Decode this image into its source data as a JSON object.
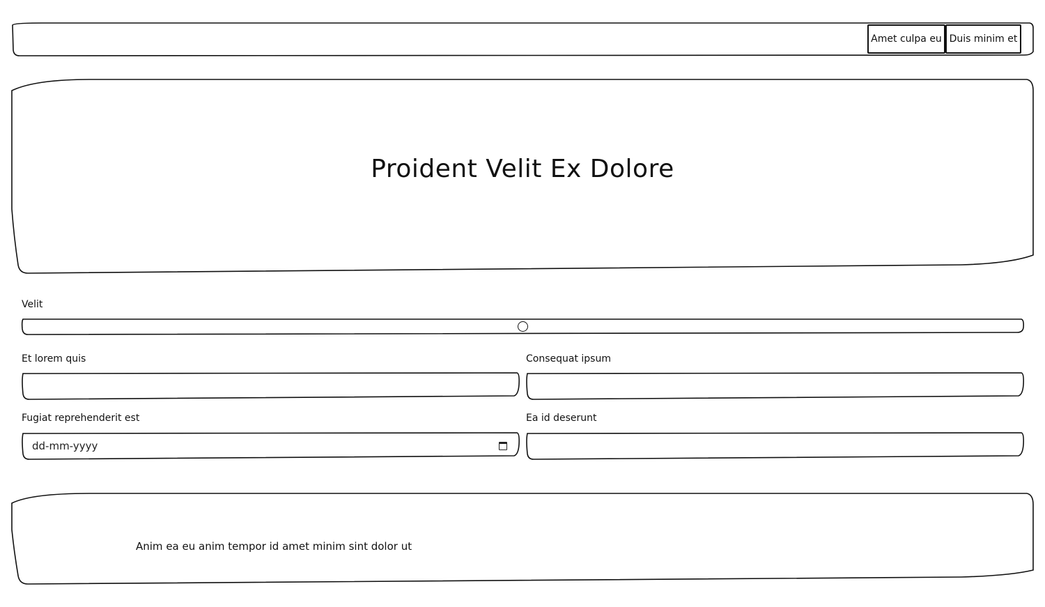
{
  "nav": {
    "buttons": [
      {
        "label": "Amet culpa eu"
      },
      {
        "label": "Duis minim et"
      }
    ]
  },
  "hero": {
    "title": "Proident Velit Ex Dolore"
  },
  "form": {
    "slider": {
      "label": "Velit",
      "value_fraction": 0.5
    },
    "field1": {
      "label": "Et lorem quis",
      "value": ""
    },
    "field2": {
      "label": "Consequat ipsum",
      "value": ""
    },
    "date": {
      "label": "Fugiat reprehenderit est",
      "placeholder": "dd-mm-yyyy"
    },
    "field4": {
      "label": "Ea id deserunt",
      "value": ""
    }
  },
  "footer": {
    "text": "Anim ea eu anim tempor id amet minim sint dolor ut"
  },
  "icons": {
    "date_picker": "calendar-icon",
    "slider_handle": "circle-thumb"
  },
  "colors": {
    "stroke": "#111111",
    "background": "#ffffff"
  }
}
